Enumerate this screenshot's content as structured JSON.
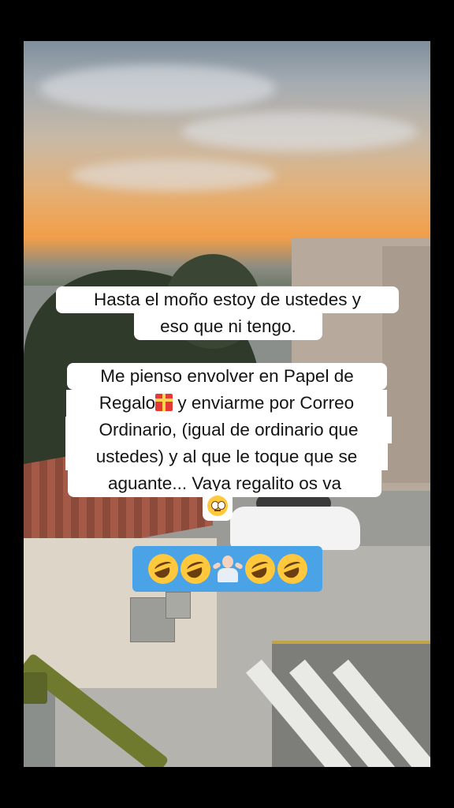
{
  "caption_1": {
    "line_1": "Hasta el moño estoy de ustedes y",
    "line_2": "eso que ni tengo."
  },
  "caption_2": {
    "line_1": "Me pienso envolver en Papel de",
    "line_2_a": "Regalo",
    "line_2_b": " y enviarme por Correo",
    "line_3": "Ordinario, (igual de ordinario que",
    "line_4": "ustedes) y al que le toque que se",
    "line_5": "aguante... Vaya regalito os va"
  },
  "emojis": {
    "gift": "gift-icon",
    "eyes": "rolling-eyes-icon",
    "bar": [
      "rofl-icon",
      "rofl-icon",
      "person-shrugging-icon",
      "rofl-icon",
      "rofl-icon"
    ]
  },
  "colors": {
    "background": "#000000",
    "caption_bg": "#ffffff",
    "emoji_bar_bg": "#4aa3e6"
  }
}
